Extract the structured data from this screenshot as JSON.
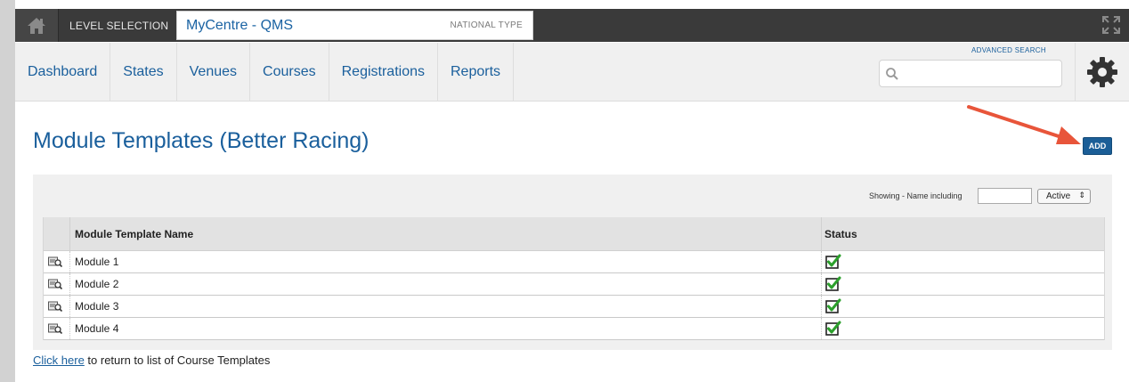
{
  "topbar": {
    "home_icon": "home-icon",
    "level_label": "LEVEL SELECTION",
    "level_name": "MyCentre - QMS",
    "level_type": "NATIONAL TYPE",
    "expand_icon": "expand-icon"
  },
  "nav": {
    "items": [
      {
        "label": "Dashboard"
      },
      {
        "label": "States"
      },
      {
        "label": "Venues"
      },
      {
        "label": "Courses"
      },
      {
        "label": "Registrations"
      },
      {
        "label": "Reports"
      }
    ],
    "search": {
      "value": "",
      "placeholder": ""
    },
    "advanced_search": "ADVANCED SEARCH",
    "settings_icon": "gear-icon"
  },
  "page": {
    "title": "Module Templates (Better Racing)",
    "add_label": "ADD"
  },
  "filter": {
    "label": "Showing - Name including",
    "value": "",
    "status_selected": "Active"
  },
  "table": {
    "headers": [
      "",
      "Module Template Name",
      "Status"
    ],
    "rows": [
      {
        "name": "Module 1",
        "status_active": true
      },
      {
        "name": "Module 2",
        "status_active": true
      },
      {
        "name": "Module 3",
        "status_active": true
      },
      {
        "name": "Module 4",
        "status_active": true
      }
    ]
  },
  "footer": {
    "link_text": "Click here",
    "rest_text": " to return to list of Course Templates"
  },
  "colors": {
    "brand_blue": "#1a5f9c",
    "topbar": "#3a3a3a",
    "arrow": "#e8553a",
    "check": "#2ca02c"
  }
}
